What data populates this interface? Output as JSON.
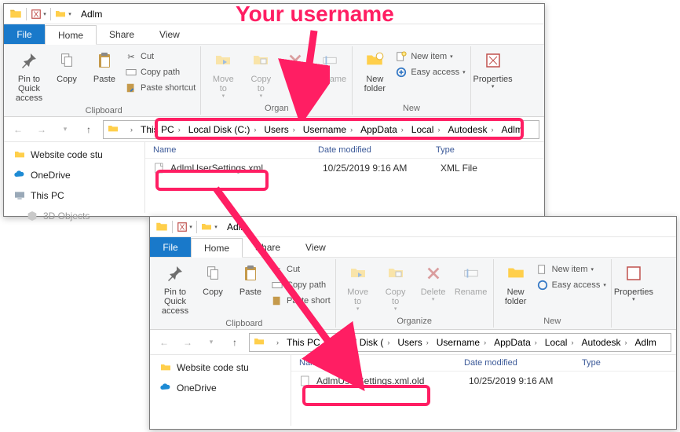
{
  "annotation": {
    "title": "Your username"
  },
  "colors": {
    "file_blue": "#1979ca",
    "highlight": "#ff1e63"
  },
  "window1": {
    "title_app": "Adlm",
    "menutabs": {
      "file": "File",
      "home": "Home",
      "share": "Share",
      "view": "View"
    },
    "ribbon": {
      "clipboard": {
        "pin": "Pin to Quick\naccess",
        "copy": "Copy",
        "paste": "Paste",
        "cut": "Cut",
        "copypath": "Copy path",
        "pasteshortcut": "Paste shortcut",
        "group": "Clipboard"
      },
      "organize": {
        "moveto": "Move\nto",
        "copyto": "Copy\nto",
        "delete": "Del",
        "rename": "Rename",
        "group": "Organ"
      },
      "new": {
        "newfolder": "New\nfolder",
        "newitem": "New item",
        "easyaccess": "Easy access",
        "group": "New"
      },
      "open": {
        "properties": "Properties"
      }
    },
    "breadcrumb": [
      "This PC",
      "Local Disk (C:)",
      "Users",
      "Username",
      "AppData",
      "Local",
      "Autodesk",
      "Adlm"
    ],
    "columns": {
      "name": "Name",
      "date": "Date modified",
      "type": "Type"
    },
    "file": {
      "name": "AdlmUserSettings.xml",
      "date": "10/25/2019 9:16 AM",
      "type": "XML File"
    },
    "sidebar": {
      "quick": "Website code stu",
      "onedrive": "OneDrive",
      "thispc": "This PC",
      "obj3d": "3D Objects"
    }
  },
  "window2": {
    "title_app": "Adlm",
    "menutabs": {
      "file": "File",
      "home": "Home",
      "share": "Share",
      "view": "View"
    },
    "ribbon": {
      "clipboard": {
        "pin": "Pin to Quick\naccess",
        "copy": "Copy",
        "paste": "Paste",
        "cut": "Cut",
        "copypath": "Copy path",
        "pasteshortcut": "Paste short",
        "group": "Clipboard"
      },
      "organize": {
        "moveto": "Move\nto",
        "copyto": "Copy\nto",
        "delete": "Delete",
        "rename": "Rename",
        "group": "Organize"
      },
      "new": {
        "newfolder": "New\nfolder",
        "newitem": "New item",
        "easyaccess": "Easy access",
        "group": "New"
      },
      "open": {
        "properties": "Properties"
      }
    },
    "breadcrumb": [
      "This PC",
      "Local Disk (",
      "Users",
      "Username",
      "AppData",
      "Local",
      "Autodesk",
      "Adlm"
    ],
    "columns": {
      "name": "Name",
      "date": "Date modified",
      "type": "Type"
    },
    "file": {
      "name": "AdlmUserSettings.xml.old",
      "date": "10/25/2019 9:16 AM",
      "type": ""
    },
    "sidebar": {
      "quick": "Website code stu",
      "onedrive": "OneDrive"
    }
  }
}
